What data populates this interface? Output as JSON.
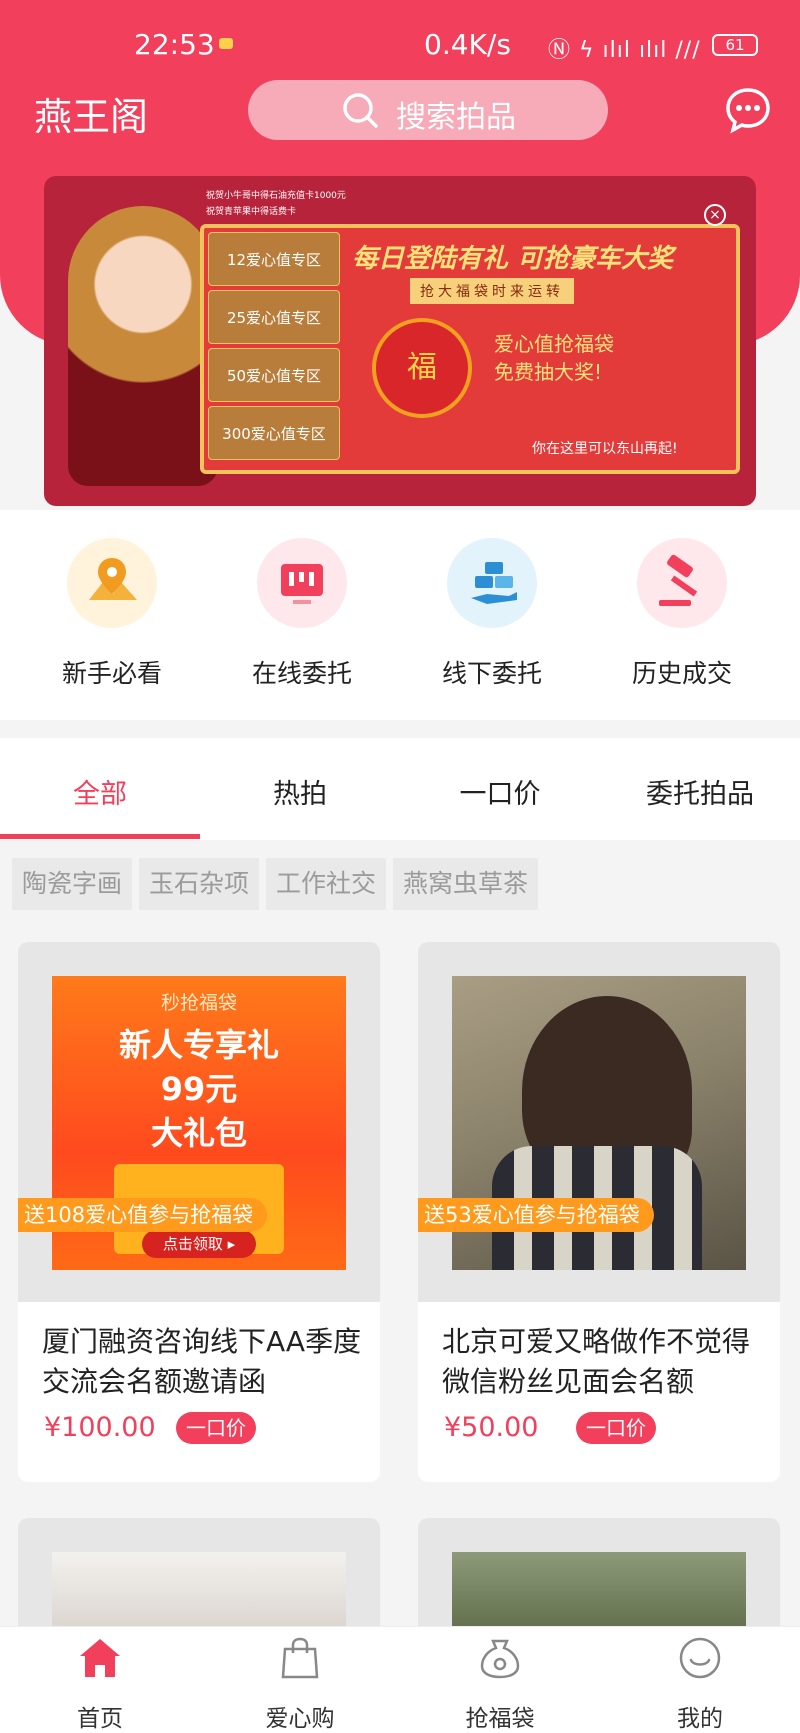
{
  "status_bar": {
    "time": "22:53",
    "network_speed": "0.4K/s",
    "signal_glyphs": "Ⓝ ϟ ılıl ılıl ///",
    "battery": "61"
  },
  "header": {
    "app_name": "燕王阁",
    "search_placeholder": "搜索拍品"
  },
  "banner": {
    "news": [
      "祝贺小牛哥中得石油充值卡1000元",
      "祝贺青苹果中得话费卡"
    ],
    "zones": [
      "12爱心值专区",
      "25爱心值专区",
      "50爱心值专区",
      "300爱心值专区"
    ],
    "headline": "每日登陆有礼  可抢豪车大奖",
    "sub": "抢大福袋时来运转",
    "bag_char": "福",
    "promo_line1": "爱心值抢福袋",
    "promo_line2": "免费抽大奖!",
    "footer": "你在这里可以东山再起!",
    "close": "×"
  },
  "quick_actions": [
    {
      "label": "新手必看",
      "icon": "map-pin-icon"
    },
    {
      "label": "在线委托",
      "icon": "online-consign-icon"
    },
    {
      "label": "线下委托",
      "icon": "offline-consign-icon"
    },
    {
      "label": "历史成交",
      "icon": "auction-hammer-icon"
    }
  ],
  "tabs": [
    "全部",
    "热拍",
    "一口价",
    "委托拍品"
  ],
  "filters": [
    "陶瓷字画",
    "玉石杂项",
    "工作社交",
    "燕窝虫草茶"
  ],
  "cards": [
    {
      "promo_top": "秒抢福袋",
      "promo_main1": "新人专享礼",
      "promo_main2": "99元",
      "promo_main3": "大礼包",
      "promo_btn": "点击领取 ▸",
      "tag": "送108爱心值参与抢福袋",
      "title": "厦门融资咨询线下AA季度交流会名额邀请函",
      "price": "¥100.00",
      "badge": "一口价"
    },
    {
      "tag": "送53爱心值参与抢福袋",
      "title": "北京可爱又略做作不觉得微信粉丝见面会名额",
      "price": "¥50.00",
      "badge": "一口价"
    }
  ],
  "tabbar": [
    {
      "label": "首页",
      "icon": "home-icon"
    },
    {
      "label": "爱心购",
      "icon": "shopping-bag-icon"
    },
    {
      "label": "抢福袋",
      "icon": "lucky-bag-icon"
    },
    {
      "label": "我的",
      "icon": "profile-icon"
    }
  ],
  "colors": {
    "brand": "#f2405c",
    "tag_orange": "#ff9a1c"
  }
}
